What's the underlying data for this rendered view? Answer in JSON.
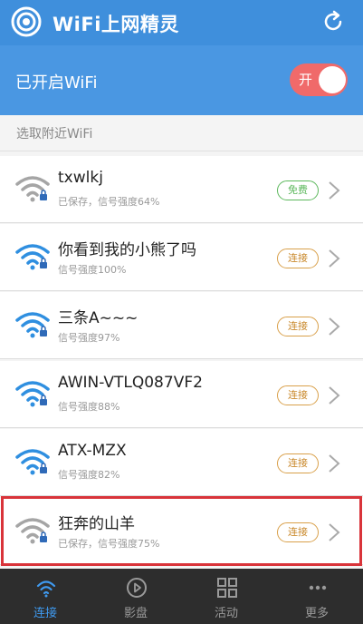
{
  "header": {
    "title": "WiFi上网精灵",
    "logo_icon": "wifi-spot-logo",
    "refresh_icon": "refresh-icon"
  },
  "wifi_bar": {
    "label": "已开启WiFi",
    "toggle_text": "开",
    "toggle_on": true
  },
  "section": {
    "label": "选取附近WiFi"
  },
  "networks": [
    {
      "name": "txwlkj",
      "sub": "已保存，信号强度64%",
      "action": "免费",
      "action_type": "free",
      "icon_color": "#a5a5a5"
    },
    {
      "name": "你看到我的小熊了吗",
      "sub": "信号强度100%",
      "action": "连接",
      "action_type": "connect",
      "icon_color": "#2f8fe0"
    },
    {
      "name": "三条A~~~",
      "sub": "信号强度97%",
      "action": "连接",
      "action_type": "connect",
      "icon_color": "#2f8fe0"
    },
    {
      "name": "AWIN-VTLQ087VF2",
      "sub": "信号强度88%",
      "action": "连接",
      "action_type": "connect",
      "icon_color": "#2f8fe0"
    },
    {
      "name": "ATX-MZX",
      "sub": "信号强度82%",
      "action": "连接",
      "action_type": "connect",
      "icon_color": "#2f8fe0"
    },
    {
      "name": "狂奔的山羊",
      "sub": "已保存，信号强度75%",
      "action": "连接",
      "action_type": "connect",
      "icon_color": "#a5a5a5"
    }
  ],
  "nav": [
    {
      "label": "连接",
      "icon": "wifi-icon",
      "active": true
    },
    {
      "label": "影盘",
      "icon": "play-icon",
      "active": false
    },
    {
      "label": "活动",
      "icon": "grid-icon",
      "active": false
    },
    {
      "label": "更多",
      "icon": "more-icon",
      "active": false
    }
  ],
  "colors": {
    "header": "#3f8fdc",
    "wifi_bar": "#4a97e2",
    "toggle": "#f06a6a",
    "highlight": "#d9343a",
    "free": "#5cb85c",
    "connect": "#c9882a"
  }
}
